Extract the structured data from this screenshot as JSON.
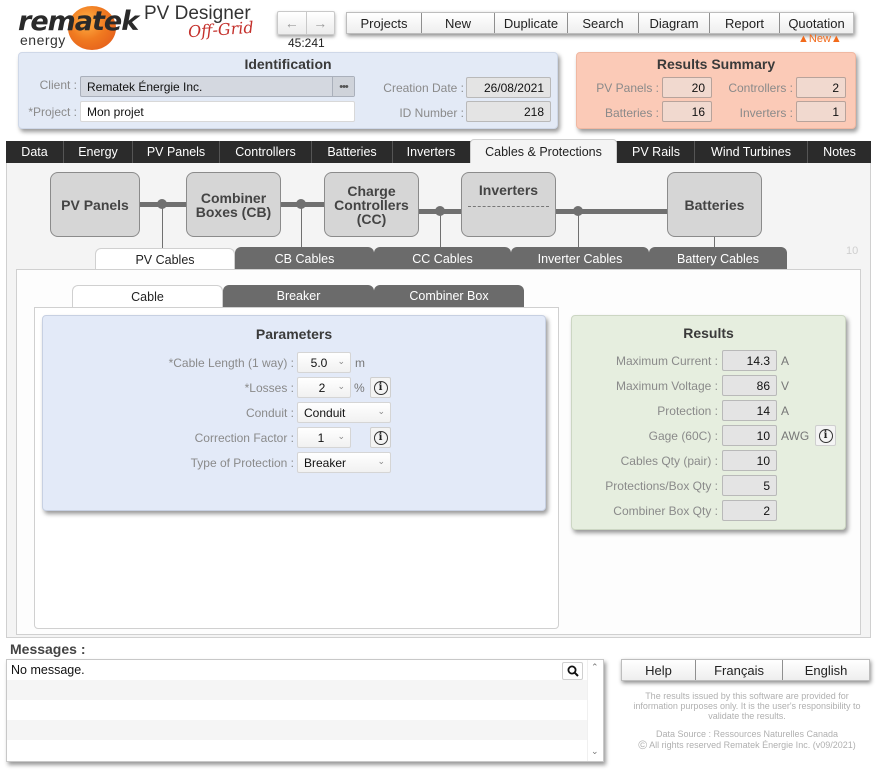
{
  "branding": {
    "logo_word": "rematek",
    "logo_sub": "energy",
    "app_title": "PV Designer",
    "app_subtitle": "Off-Grid"
  },
  "navigation": {
    "back_icon": "arrow-left-icon",
    "forward_icon": "arrow-right-icon",
    "record_counter": "45:241"
  },
  "toolbar": {
    "buttons": [
      "Projects",
      "New",
      "Duplicate",
      "Search",
      "Diagram",
      "Report",
      "Quotation"
    ],
    "new_badge": "▲New▲"
  },
  "identification": {
    "title": "Identification",
    "client_label": "Client :",
    "client_value": "Rematek Énergie Inc.",
    "client_more": "•••",
    "project_label": "*Project :",
    "project_value": "Mon projet",
    "creation_date_label": "Creation Date :",
    "creation_date_value": "26/08/2021",
    "id_label": "ID Number :",
    "id_value": "218"
  },
  "results_summary": {
    "title": "Results Summary",
    "pv_panels_label": "PV Panels :",
    "pv_panels_value": "20",
    "controllers_label": "Controllers :",
    "controllers_value": "2",
    "batteries_label": "Batteries :",
    "batteries_value": "16",
    "inverters_label": "Inverters :",
    "inverters_value": "1"
  },
  "main_tabs": [
    {
      "label": "Data",
      "active": false
    },
    {
      "label": "Energy",
      "active": false
    },
    {
      "label": "PV Panels",
      "active": false
    },
    {
      "label": "Controllers",
      "active": false
    },
    {
      "label": "Batteries",
      "active": false
    },
    {
      "label": "Inverters",
      "active": false
    },
    {
      "label": "Cables & Protections",
      "active": true
    },
    {
      "label": "PV Rails",
      "active": false
    },
    {
      "label": "Wind Turbines",
      "active": false
    },
    {
      "label": "Notes",
      "active": false
    }
  ],
  "diagram": {
    "boxes": [
      "PV Panels",
      "Combiner\nBoxes (CB)",
      "Charge\nControllers\n(CC)",
      "Inverters",
      "Batteries"
    ]
  },
  "cable_tabs": [
    {
      "label": "PV Cables",
      "active": true
    },
    {
      "label": "CB Cables",
      "active": false
    },
    {
      "label": "CC Cables",
      "active": false
    },
    {
      "label": "Inverter Cables",
      "active": false
    },
    {
      "label": "Battery Cables",
      "active": false
    }
  ],
  "page_indicator": "10",
  "sub_tabs": [
    {
      "label": "Cable",
      "active": true
    },
    {
      "label": "Breaker",
      "active": false
    },
    {
      "label": "Combiner Box",
      "active": false
    }
  ],
  "parameters": {
    "title": "Parameters",
    "cable_length_label": "*Cable Length (1 way) :",
    "cable_length_value": "5.0",
    "cable_length_unit": "m",
    "losses_label": "*Losses :",
    "losses_value": "2",
    "losses_unit": "%",
    "conduit_label": "Conduit :",
    "conduit_value": "Conduit",
    "correction_label": "Correction Factor :",
    "correction_value": "1",
    "protection_type_label": "Type of Protection :",
    "protection_type_value": "Breaker"
  },
  "results": {
    "title": "Results",
    "rows": [
      {
        "label": "Maximum Current :",
        "value": "14.3",
        "unit": "A"
      },
      {
        "label": "Maximum Voltage :",
        "value": "86",
        "unit": "V"
      },
      {
        "label": "Protection :",
        "value": "14",
        "unit": "A"
      },
      {
        "label": "Gage (60C) :",
        "value": "10",
        "unit": "AWG"
      },
      {
        "label": "Cables Qty (pair) :",
        "value": "10",
        "unit": ""
      },
      {
        "label": "Protections/Box Qty :",
        "value": "5",
        "unit": ""
      },
      {
        "label": "Combiner Box Qty :",
        "value": "2",
        "unit": ""
      }
    ]
  },
  "messages": {
    "label": "Messages :",
    "rows": [
      "No message.",
      "",
      "",
      "",
      ""
    ]
  },
  "footer": {
    "buttons": [
      "Help",
      "Français",
      "English"
    ],
    "disclaimer": "The results issued by this software are provided for information purposes only. It is the user's responsibility to validate the results.",
    "data_source": "Data Source : Ressources Naturelles Canada",
    "copyright_symbol": "©",
    "copyright": "All rights reserved Rematek Énergie Inc. (v09/2021)"
  }
}
